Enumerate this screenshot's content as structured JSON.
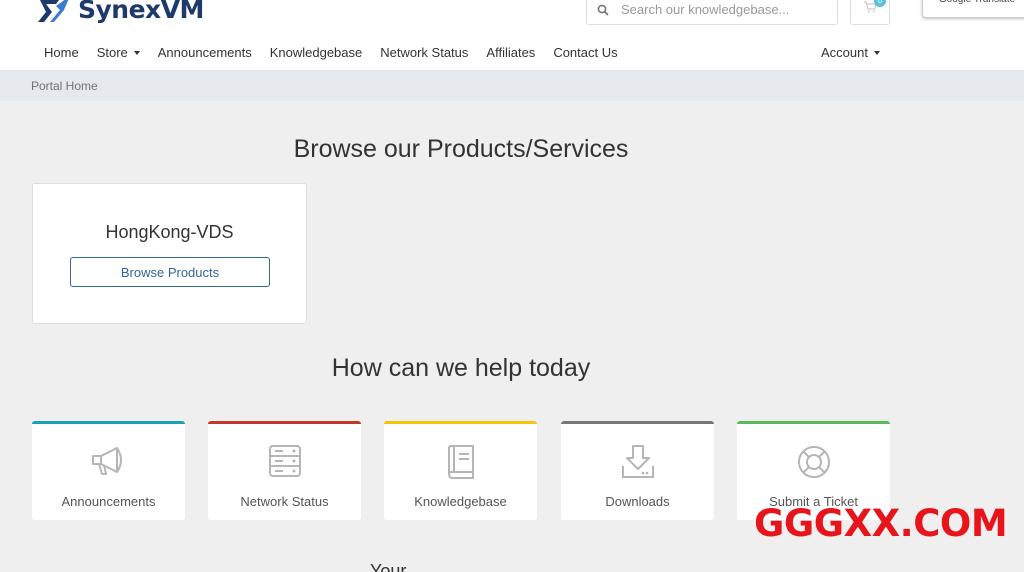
{
  "brand": {
    "name_prefix": "Synex",
    "name_suffix": "VM",
    "color": "#1d3a6b"
  },
  "search": {
    "placeholder": "Search our knowledgebase..."
  },
  "cart": {
    "count": "0"
  },
  "translate": {
    "label": "Google Translate"
  },
  "nav": {
    "items": [
      {
        "label": "Home",
        "dropdown": false
      },
      {
        "label": "Store",
        "dropdown": true
      },
      {
        "label": "Announcements",
        "dropdown": false
      },
      {
        "label": "Knowledgebase",
        "dropdown": false
      },
      {
        "label": "Network Status",
        "dropdown": false
      },
      {
        "label": "Affiliates",
        "dropdown": false
      },
      {
        "label": "Contact Us",
        "dropdown": false
      }
    ],
    "account_label": "Account"
  },
  "breadcrumb": {
    "current": "Portal Home"
  },
  "products": {
    "title": "Browse our Products/Services",
    "cards": [
      {
        "name": "HongKong-VDS",
        "button_label": "Browse Products"
      }
    ]
  },
  "help": {
    "title": "How can we help today",
    "cards": [
      {
        "label": "Announcements",
        "icon": "megaphone-icon",
        "accent": "#17a2b8"
      },
      {
        "label": "Network Status",
        "icon": "server-icon",
        "accent": "#c0392b"
      },
      {
        "label": "Knowledgebase",
        "icon": "book-icon",
        "accent": "#f1c40f"
      },
      {
        "label": "Downloads",
        "icon": "download-icon",
        "accent": "#777777"
      },
      {
        "label": "Submit a Ticket",
        "icon": "lifebuoy-icon",
        "accent": "#5cb85c"
      }
    ]
  },
  "footer_peek": {
    "text": "Your Account"
  },
  "watermark": {
    "text": "GGGXX.COM",
    "color": "#e8141c"
  }
}
